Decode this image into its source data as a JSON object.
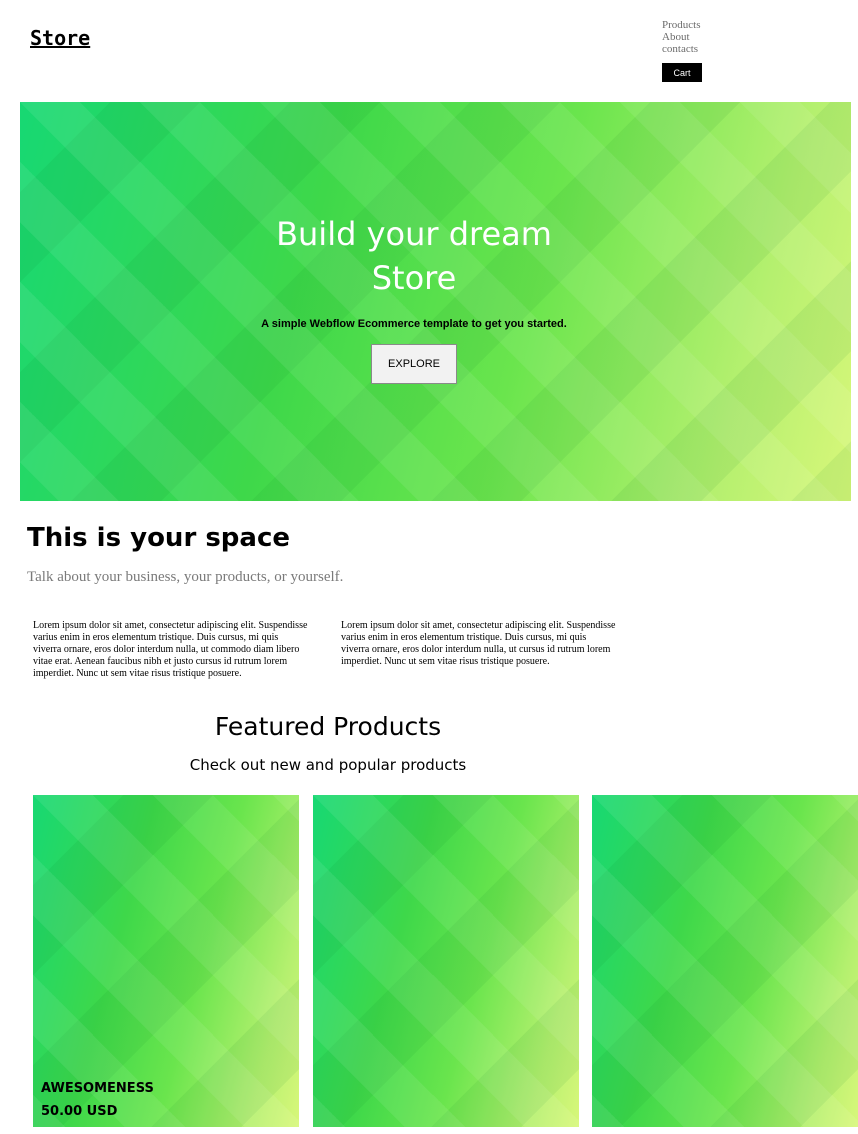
{
  "header": {
    "logo": "Store",
    "nav": [
      "Products",
      "About",
      "contacts"
    ],
    "cart_label": "Cart"
  },
  "hero": {
    "title_line1": "Build your dream",
    "title_line2": "Store",
    "subtitle": "A simple Webflow Ecommerce template to get you started.",
    "button_label": "EXPLORE"
  },
  "about": {
    "title": "This is your space",
    "subtitle": "Talk about your business, your products, or yourself.",
    "paragraphs": [
      "Lorem ipsum dolor sit amet, consectetur adipiscing elit. Suspendisse varius enim in eros elementum tristique. Duis cursus, mi quis viverra ornare, eros dolor interdum nulla, ut commodo diam libero vitae erat. Aenean faucibus nibh et justo cursus id rutrum lorem imperdiet. Nunc ut sem vitae risus tristique posuere.",
      "Lorem ipsum dolor sit amet, consectetur adipiscing elit. Suspendisse varius enim in eros elementum tristique. Duis cursus, mi quis viverra ornare, eros dolor interdum nulla, ut cursus id rutrum lorem imperdiet. Nunc ut sem vitae risus tristique posuere."
    ]
  },
  "featured": {
    "title": "Featured Products",
    "subtitle": "Check out new and popular products",
    "products": [
      {
        "name": "AWESOMENESS",
        "price": "50.00 USD"
      },
      {
        "name": "",
        "price": ""
      },
      {
        "name": "",
        "price": ""
      }
    ]
  },
  "colors": {
    "hero_green": "#3fd44c",
    "hero_light_green": "#d8f77a",
    "cart_bg": "#000000"
  }
}
